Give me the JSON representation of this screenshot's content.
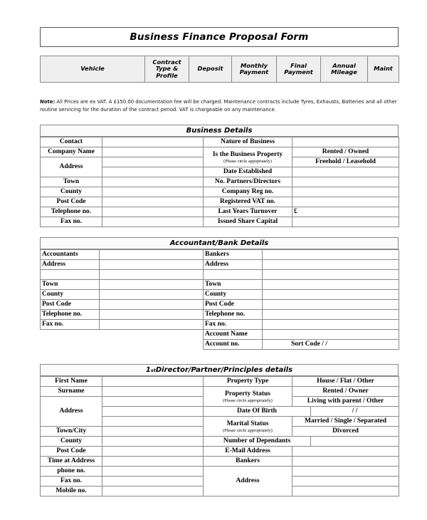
{
  "document": {
    "title": "Business Finance Proposal Form"
  },
  "vehicle_table": {
    "columns": [
      "Vehicle",
      "Contract Type & Profile",
      "Deposit",
      "Monthly Payment",
      "Final Payment",
      "Annual Mileage",
      "Maint"
    ]
  },
  "note": {
    "label": "Note:",
    "text": " All Prices are ex VAT. A £150.00 documentation fee will be charged. Maintenance contracts include Tyres, Exhausts, Batteries and all other routine servicing for the duration of the contract period. VAT is chargeable on any maintenance."
  },
  "business_details": {
    "heading": "Business Details",
    "left_labels": {
      "contact": "Contact",
      "company_name": "Company Name",
      "address": "Address",
      "town": "Town",
      "county": "County",
      "post_code": "Post Code",
      "telephone": "Telephone no.",
      "fax": "Fax no."
    },
    "right_labels": {
      "nature_of_business": "Nature of Business",
      "is_business_property": "Is the Business Property",
      "please_circle": "(Please circle appopriately)",
      "date_established": "Date Established",
      "no_partners": "No. Partners/Directors",
      "company_reg": "Company Reg no.",
      "registered_vat": "Registered VAT no.",
      "last_years_turnover": "Last Years Turnover",
      "issued_share_capital": "Issued Share Capital"
    },
    "right_values": {
      "rented_owned": "Rented / Owned",
      "freehold_leasehold": "Freehold / Leasehold",
      "turnover_currency": "£"
    }
  },
  "accountant_bank": {
    "heading": "Accountant/Bank Details",
    "left_labels": {
      "accountants": "Accountants",
      "address": "Address",
      "town": "Town",
      "county": "County",
      "post_code": "Post Code",
      "telephone": "Telephone no.",
      "fax": "Fax no."
    },
    "right_labels": {
      "bankers": "Bankers",
      "address": "Address",
      "town": "Town",
      "county": "County",
      "post_code": "Post Code",
      "telephone": "Telephone no.",
      "fax": "Fax no.",
      "account_name": "Account Name",
      "account_no": "Account no."
    },
    "right_values": {
      "sort_code": "Sort Code  /  /"
    }
  },
  "director_details": {
    "heading_prefix": "1",
    "heading_sup": "st",
    "heading_rest": " Director/Partner/Principles details",
    "left_labels": {
      "first_name": "First Name",
      "surname": "Surname",
      "address": "Address",
      "town_city": "Town/City",
      "county": "County",
      "post_code": "Post Code",
      "time_at_address": "Time at Address",
      "phone_no": "phone no.",
      "fax_no": "Fax no.",
      "mobile_no": "Mobile no."
    },
    "right_labels": {
      "property_type": "Property Type",
      "property_status": "Property Status",
      "please_circle": "(Please circle appropriately)",
      "date_of_birth": "Date Of Birth",
      "marital_status": "Marital Status",
      "please_circle2": "(Please circle appropriately)",
      "number_of_dependants": "Number of Dependants",
      "email_address": "E-Mail Address",
      "bankers": "Bankers",
      "address": "Address"
    },
    "right_values": {
      "house_flat_other": "House / Flat / Other",
      "rented_owner": "Rented / Owner",
      "living_with_parent": "Living with parent / Other",
      "dob_value": "/   /",
      "marital_line1": "Married / Single / Separated",
      "marital_line2": "Divorced"
    }
  }
}
